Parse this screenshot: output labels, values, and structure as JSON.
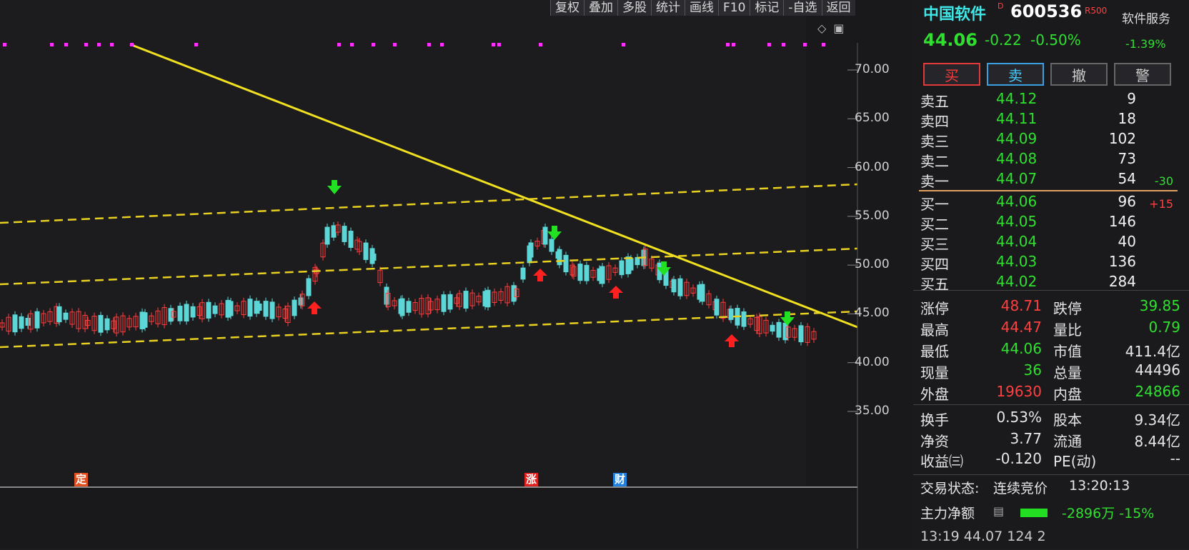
{
  "toolbar": {
    "buttons": [
      "复权",
      "叠加",
      "多股",
      "统计",
      "画线",
      "F10",
      "标记",
      "-自选",
      "返回"
    ]
  },
  "top_icons": [
    "diamond-icon",
    "window-icon"
  ],
  "axis": {
    "labels": [
      "70.00",
      "65.00",
      "60.00",
      "55.00",
      "50.00",
      "45.00",
      "40.00",
      "35.00"
    ],
    "values": [
      70,
      65,
      60,
      55,
      50,
      45,
      40,
      35
    ]
  },
  "chart_markers": [
    {
      "text": "定",
      "color": "#e05020"
    },
    {
      "text": "涨",
      "color": "#e02020"
    },
    {
      "text": "财",
      "color": "#2080e0"
    }
  ],
  "stock": {
    "name": "中国软件",
    "badge": "D",
    "code": "600536",
    "rbadge": "R500",
    "sector": "软件服务",
    "last": "44.06",
    "change": "-0.22",
    "pct": "-0.50%",
    "sector_pct": "-1.39%"
  },
  "trade_buttons": [
    "买",
    "卖",
    "撤",
    "警"
  ],
  "order_book": {
    "asks": [
      {
        "label": "卖五",
        "price": "44.12",
        "vol": "9"
      },
      {
        "label": "卖四",
        "price": "44.11",
        "vol": "18"
      },
      {
        "label": "卖三",
        "price": "44.09",
        "vol": "102"
      },
      {
        "label": "卖二",
        "price": "44.08",
        "vol": "73"
      },
      {
        "label": "卖一",
        "price": "44.07",
        "vol": "54",
        "delta": "-30"
      }
    ],
    "bids": [
      {
        "label": "买一",
        "price": "44.06",
        "vol": "96",
        "delta": "+15"
      },
      {
        "label": "买二",
        "price": "44.05",
        "vol": "146"
      },
      {
        "label": "买三",
        "price": "44.04",
        "vol": "40"
      },
      {
        "label": "买四",
        "price": "44.03",
        "vol": "136"
      },
      {
        "label": "买五",
        "price": "44.02",
        "vol": "284"
      }
    ]
  },
  "stats": {
    "zt_k": "涨停",
    "zt_v": "48.71",
    "dt_k": "跌停",
    "dt_v": "39.85",
    "high_k": "最高",
    "high_v": "44.47",
    "lb_k": "量比",
    "lb_v": "0.79",
    "low_k": "最低",
    "low_v": "44.06",
    "mv_k": "市值",
    "mv_v": "411.4亿",
    "cur_k": "现量",
    "cur_v": "36",
    "tot_k": "总量",
    "tot_v": "44496",
    "out_k": "外盘",
    "out_v": "19630",
    "in_k": "内盘",
    "in_v": "24866",
    "hs_k": "换手",
    "hs_v": "0.53%",
    "gb_k": "股本",
    "gb_v": "9.34亿",
    "jz_k": "净资",
    "jz_v": "3.77",
    "lt_k": "流通",
    "lt_v": "8.44亿",
    "sy_k": "收益㈢",
    "sy_v": "-0.120",
    "pe_k": "PE(动)",
    "pe_v": "--"
  },
  "status": {
    "label": "交易状态:",
    "value": "连续竞价",
    "time": "13:20:13"
  },
  "flow": {
    "label": "主力净额",
    "value": "-2896万 -15%"
  },
  "bottom_row": "13:19    44.07    124    2"
}
